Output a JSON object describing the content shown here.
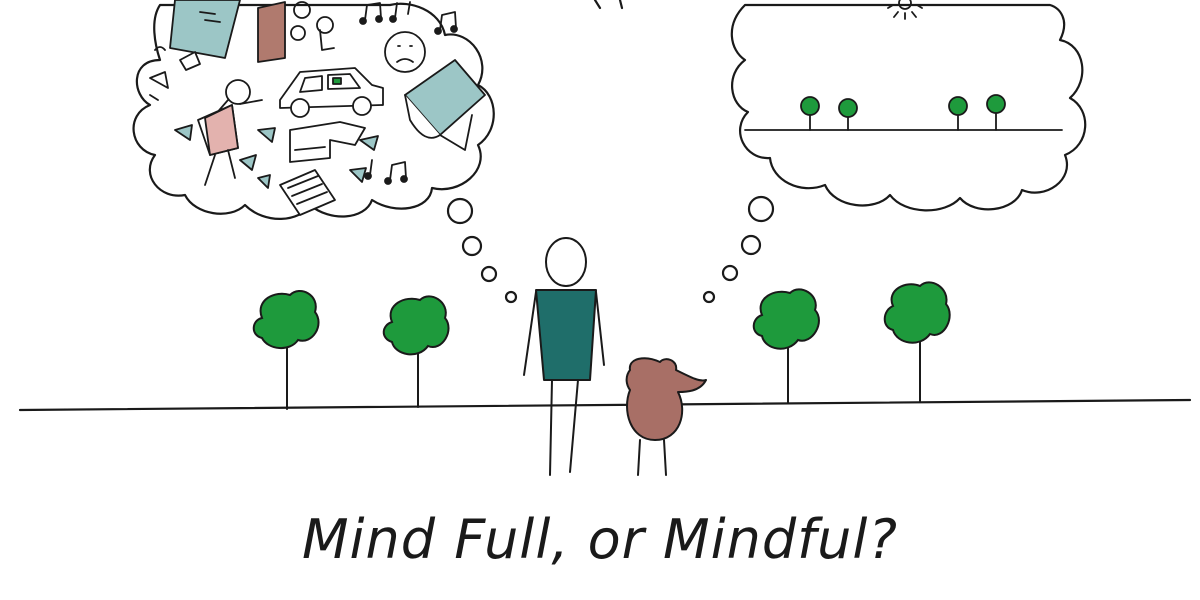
{
  "caption": "Mind Full, or Mindful?",
  "colors": {
    "ink": "#1a1a1a",
    "tree_green": "#1e9a3c",
    "shirt_teal": "#1f6e6a",
    "dog_brown": "#a86f66",
    "paper_teal": "#9cc6c6",
    "box_brown": "#b07a6e",
    "dress_pink": "#e3b2ae"
  },
  "icons": [
    "stick-figure",
    "dog",
    "tree",
    "thought-cloud",
    "car",
    "music-notes",
    "sun"
  ]
}
